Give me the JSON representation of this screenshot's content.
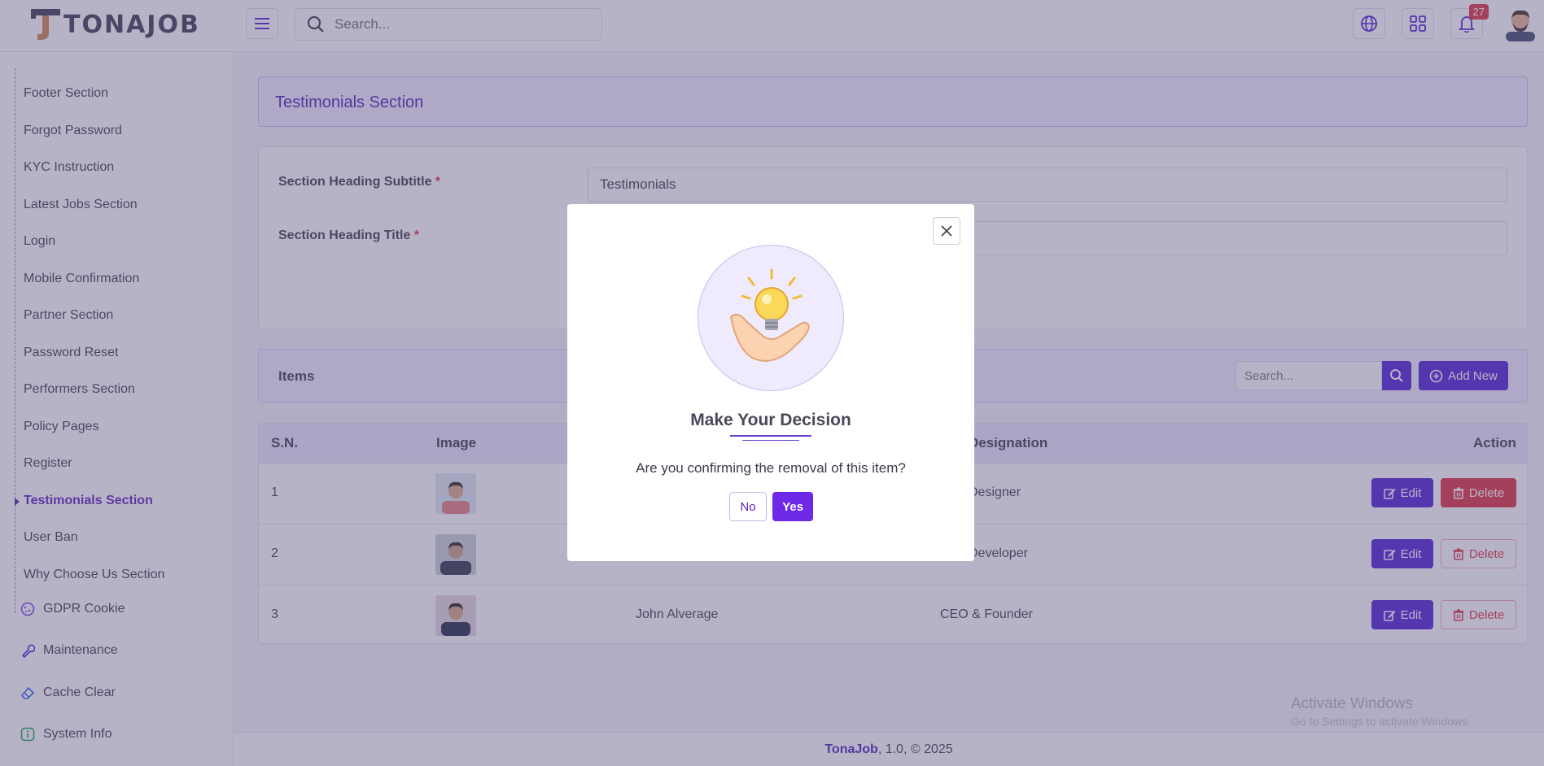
{
  "header": {
    "logo_text": "TONAJOB",
    "search_placeholder": "Search...",
    "notification_count": "27"
  },
  "sidebar": {
    "sub_items": [
      {
        "label": "Footer Section"
      },
      {
        "label": "Forgot Password"
      },
      {
        "label": "KYC Instruction"
      },
      {
        "label": "Latest Jobs Section"
      },
      {
        "label": "Login"
      },
      {
        "label": "Mobile Confirmation"
      },
      {
        "label": "Partner Section"
      },
      {
        "label": "Password Reset"
      },
      {
        "label": "Performers Section"
      },
      {
        "label": "Policy Pages"
      },
      {
        "label": "Register"
      },
      {
        "label": "Testimonials Section",
        "active": true
      },
      {
        "label": "User Ban"
      },
      {
        "label": "Why Choose Us Section"
      }
    ],
    "main_items": [
      {
        "label": "GDPR Cookie",
        "icon": "cookie-icon"
      },
      {
        "label": "Maintenance",
        "icon": "wrench-icon"
      },
      {
        "label": "Cache Clear",
        "icon": "eraser-icon"
      },
      {
        "label": "System Info",
        "icon": "info-icon"
      }
    ]
  },
  "page": {
    "title": "Testimonials Section",
    "form": {
      "subtitle_label": "Section Heading Subtitle",
      "subtitle_value": "Testimonials",
      "title_label": "Section Heading Title",
      "required_mark": "*"
    },
    "items": {
      "label": "Items",
      "search_placeholder": "Search...",
      "add_new_label": "Add New"
    },
    "table": {
      "headers": {
        "sn": "S.N.",
        "image": "Image",
        "designation": "Designation",
        "action": "Action"
      },
      "rows": [
        {
          "sn": "1",
          "name": "",
          "designation": "Designer",
          "edit": "Edit",
          "delete": "Delete"
        },
        {
          "sn": "2",
          "name": "",
          "designation": "Developer",
          "edit": "Edit",
          "delete": "Delete"
        },
        {
          "sn": "3",
          "name": "John Alverage",
          "designation": "CEO & Founder",
          "edit": "Edit",
          "delete": "Delete"
        }
      ]
    }
  },
  "footer": {
    "brand": "TonaJob",
    "rest": ", 1.0, © 2025"
  },
  "watermark": {
    "line1": "Activate Windows",
    "line2": "Go to Settings to activate Windows."
  },
  "modal": {
    "title": "Make Your Decision",
    "message": "Are you confirming the removal of this item?",
    "no_label": "No",
    "yes_label": "Yes"
  },
  "colors": {
    "primary": "#4c1dd4",
    "danger": "#dc2f3c",
    "accent_text": "#4a1fb8"
  }
}
